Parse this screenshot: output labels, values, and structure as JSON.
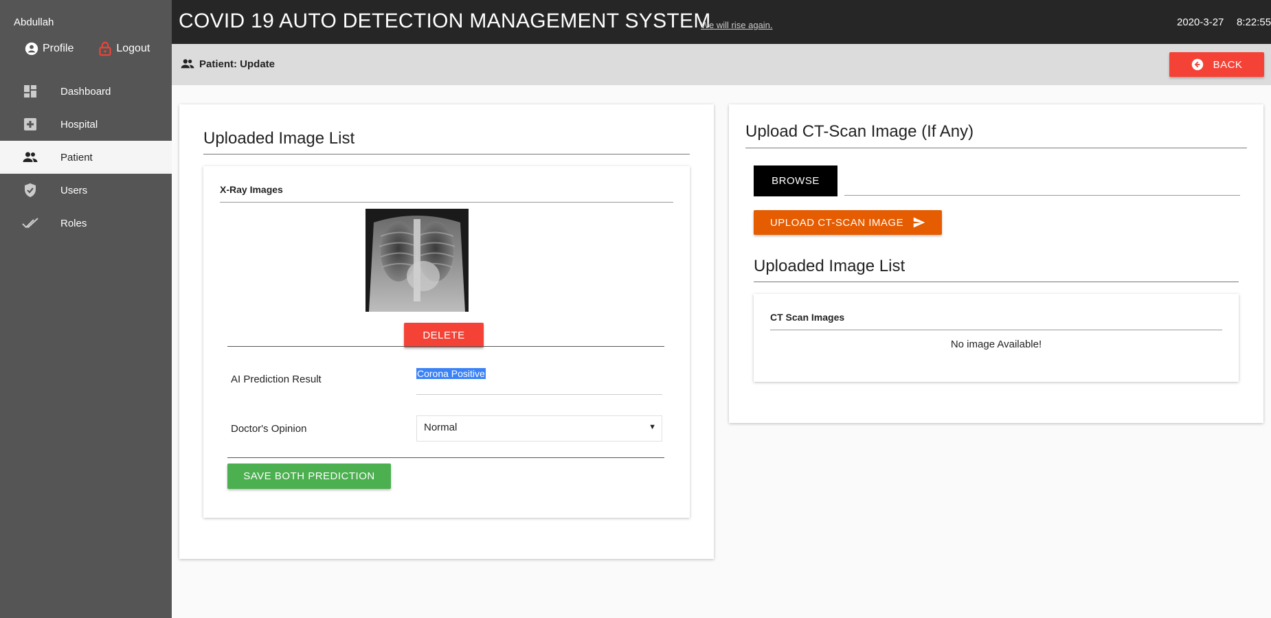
{
  "sidebar": {
    "user_name": "Abdullah",
    "profile_label": "Profile",
    "logout_label": "Logout",
    "items": [
      {
        "label": "Dashboard",
        "icon": "dashboard-icon"
      },
      {
        "label": "Hospital",
        "icon": "hospital-plus-icon"
      },
      {
        "label": "Patient",
        "icon": "people-icon",
        "active": true
      },
      {
        "label": "Users",
        "icon": "shield-check-icon"
      },
      {
        "label": "Roles",
        "icon": "double-check-icon"
      }
    ]
  },
  "header": {
    "title": "COVID 19 AUTO DETECTION MANAGEMENT SYSTEM",
    "tagline": "We will rise again.",
    "date": "2020-3-27",
    "time": "8:22:55"
  },
  "subbar": {
    "breadcrumb": "Patient: Update",
    "back_label": "BACK"
  },
  "left_panel": {
    "title": "Uploaded Image List",
    "xray_heading": "X-Ray Images",
    "delete_label": "DELETE",
    "ai_label": "AI Prediction Result",
    "ai_value": "Corona Positive",
    "opinion_label": "Doctor's Opinion",
    "opinion_value": "Normal",
    "save_label": "SAVE BOTH PREDICTION"
  },
  "right_panel": {
    "title": "Upload CT-Scan Image (If Any)",
    "browse_label": "BROWSE",
    "upload_label": "UPLOAD CT-SCAN IMAGE",
    "list_title": "Uploaded Image List",
    "ct_heading": "CT Scan Images",
    "empty_text": "No image Available!"
  },
  "colors": {
    "sidebar_bg": "#555555",
    "header_bg": "#262626",
    "danger": "#f44336",
    "success": "#4caf50",
    "upload": "#e65c00"
  }
}
